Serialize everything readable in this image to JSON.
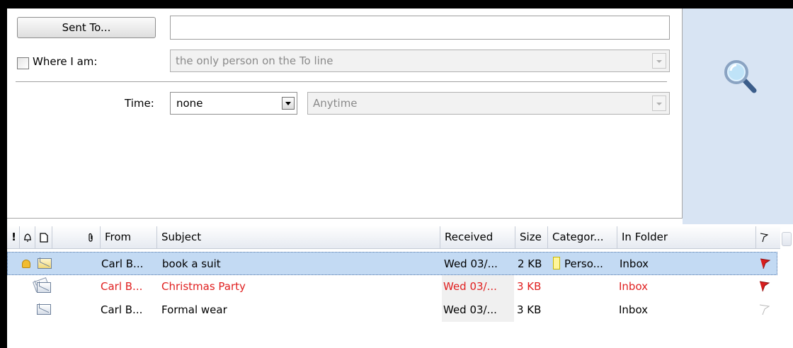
{
  "criteria": {
    "sent_to_button": "Sent To...",
    "sent_to_value": "",
    "where_checkbox_label": "Where I am:",
    "where_checked": false,
    "where_select_value": "the only person on the To line",
    "time_label": "Time:",
    "time_select_value": "none",
    "time_range_value": "Anytime"
  },
  "search_icon": "magnifier-icon",
  "columns": {
    "importance": "!",
    "reminder": "reminder-bell-icon",
    "icon": "page-icon",
    "attachment": "paperclip-icon",
    "from": "From",
    "subject": "Subject",
    "received": "Received",
    "size": "Size",
    "categories": "Categor...",
    "folder": "In Folder",
    "flag": "flag-icon"
  },
  "messages": [
    {
      "from": "Carl B...",
      "subject": "book a suit",
      "received": "Wed 03/...",
      "size": "2 KB",
      "category": "Perso...",
      "folder": "Inbox",
      "selected": true,
      "unread": false,
      "reminder": true,
      "flag": "red",
      "icon": "envelope-open-icon"
    },
    {
      "from": "Carl B...",
      "subject": "Christmas Party",
      "received": "Wed 03/...",
      "size": "3 KB",
      "category": "",
      "folder": "Inbox",
      "selected": false,
      "overdue": true,
      "reminder": false,
      "flag": "red",
      "icon": "envelope-stack-icon"
    },
    {
      "from": "Carl B...",
      "subject": "Formal wear",
      "received": "Wed 03/...",
      "size": "3 KB",
      "category": "",
      "folder": "Inbox",
      "selected": false,
      "reminder": false,
      "flag": "none",
      "icon": "envelope-open-icon"
    }
  ],
  "colors": {
    "selection": "#c3daf3",
    "overdue_text": "#e02020",
    "flag_red": "#d81e1e",
    "side_panel": "#d8e4f3"
  }
}
